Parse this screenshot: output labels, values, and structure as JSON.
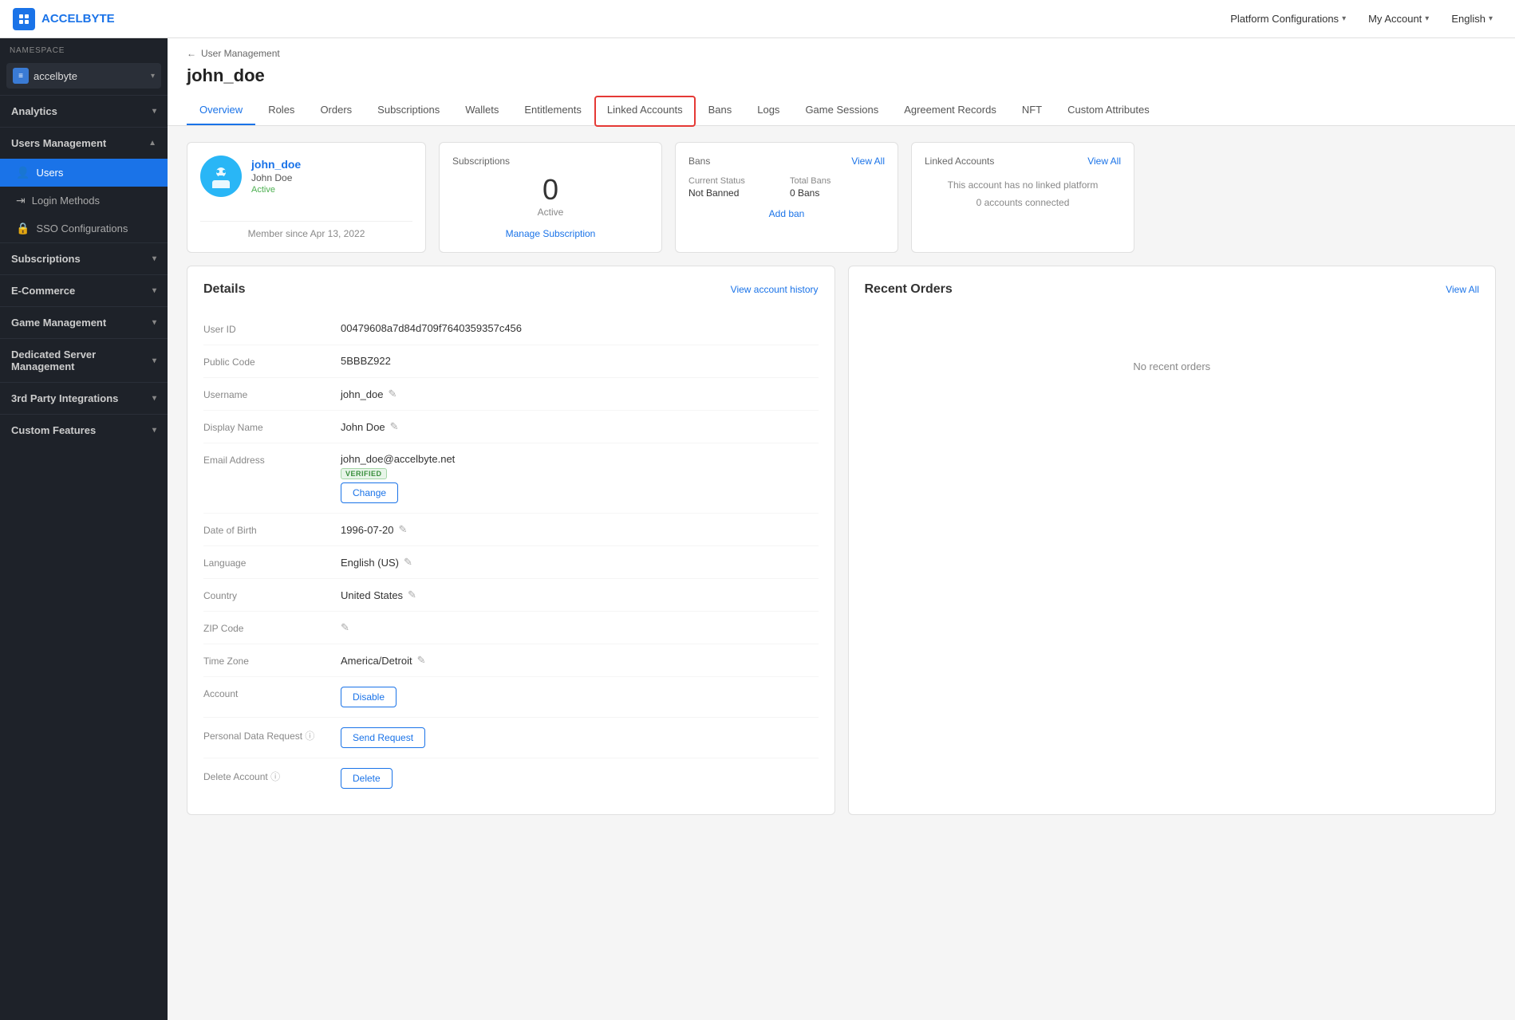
{
  "topNav": {
    "logo": "A3",
    "appName": "ACCELBYTE",
    "platformConfigurations": "Platform Configurations",
    "myAccount": "My Account",
    "language": "English"
  },
  "sidebar": {
    "namespace_label": "NAMESPACE",
    "namespace_value": "accelbyte",
    "sections": [
      {
        "id": "analytics",
        "label": "Analytics",
        "expanded": false,
        "items": []
      },
      {
        "id": "users-management",
        "label": "Users Management",
        "expanded": true,
        "items": [
          {
            "id": "users",
            "label": "Users",
            "icon": "👤",
            "active": true
          },
          {
            "id": "login-methods",
            "label": "Login Methods",
            "icon": "→",
            "active": false
          },
          {
            "id": "sso-configurations",
            "label": "SSO Configurations",
            "icon": "🔒",
            "active": false
          }
        ]
      },
      {
        "id": "subscriptions",
        "label": "Subscriptions",
        "expanded": false,
        "items": []
      },
      {
        "id": "ecommerce",
        "label": "E-Commerce",
        "expanded": false,
        "items": []
      },
      {
        "id": "game-management",
        "label": "Game Management",
        "expanded": false,
        "items": []
      },
      {
        "id": "dedicated-server",
        "label": "Dedicated Server Management",
        "expanded": false,
        "items": []
      },
      {
        "id": "3rd-party",
        "label": "3rd Party Integrations",
        "expanded": false,
        "items": []
      },
      {
        "id": "custom-features",
        "label": "Custom Features",
        "expanded": false,
        "items": []
      }
    ]
  },
  "breadcrumb": {
    "parent": "User Management",
    "arrow": "←"
  },
  "pageTitle": "john_doe",
  "tabs": [
    {
      "id": "overview",
      "label": "Overview",
      "active": true,
      "highlighted": false
    },
    {
      "id": "roles",
      "label": "Roles",
      "active": false,
      "highlighted": false
    },
    {
      "id": "orders",
      "label": "Orders",
      "active": false,
      "highlighted": false
    },
    {
      "id": "subscriptions",
      "label": "Subscriptions",
      "active": false,
      "highlighted": false
    },
    {
      "id": "wallets",
      "label": "Wallets",
      "active": false,
      "highlighted": false
    },
    {
      "id": "entitlements",
      "label": "Entitlements",
      "active": false,
      "highlighted": false
    },
    {
      "id": "linked-accounts",
      "label": "Linked Accounts",
      "active": false,
      "highlighted": true
    },
    {
      "id": "bans",
      "label": "Bans",
      "active": false,
      "highlighted": false
    },
    {
      "id": "logs",
      "label": "Logs",
      "active": false,
      "highlighted": false
    },
    {
      "id": "game-sessions",
      "label": "Game Sessions",
      "active": false,
      "highlighted": false
    },
    {
      "id": "agreement-records",
      "label": "Agreement Records",
      "active": false,
      "highlighted": false
    },
    {
      "id": "nft",
      "label": "NFT",
      "active": false,
      "highlighted": false
    },
    {
      "id": "custom-attributes",
      "label": "Custom Attributes",
      "active": false,
      "highlighted": false
    }
  ],
  "userCard": {
    "username": "john_doe",
    "displayName": "John Doe",
    "status": "Active",
    "memberSince": "Member since Apr 13, 2022",
    "avatarIcon": "👾"
  },
  "subscriptions": {
    "title": "Subscriptions",
    "count": "0",
    "countLabel": "Active",
    "manageLink": "Manage Subscription"
  },
  "bans": {
    "title": "Bans",
    "viewAllLabel": "View All",
    "currentStatusLabel": "Current Status",
    "currentStatusValue": "Not Banned",
    "totalBansLabel": "Total Bans",
    "totalBansValue": "0 Bans",
    "addBanLabel": "Add ban"
  },
  "linkedAccounts": {
    "title": "Linked Accounts",
    "viewAllLabel": "View All",
    "emptyMessage": "This account has no linked platform",
    "connectedCount": "0 accounts connected"
  },
  "details": {
    "title": "Details",
    "viewHistoryLabel": "View account history",
    "fields": [
      {
        "id": "user-id",
        "label": "User ID",
        "value": "00479608a7d84d709f7640359357c456",
        "editable": false
      },
      {
        "id": "public-code",
        "label": "Public Code",
        "value": "5BBBZ922",
        "editable": false
      },
      {
        "id": "username",
        "label": "Username",
        "value": "john_doe",
        "editable": true
      },
      {
        "id": "display-name",
        "label": "Display Name",
        "value": "John Doe",
        "editable": true
      },
      {
        "id": "email-address",
        "label": "Email Address",
        "value": "john_doe@accelbyte.net",
        "editable": false,
        "verified": true,
        "changeBtn": "Change"
      },
      {
        "id": "date-of-birth",
        "label": "Date of Birth",
        "value": "1996-07-20",
        "editable": true
      },
      {
        "id": "language",
        "label": "Language",
        "value": "English (US)",
        "editable": true
      },
      {
        "id": "country",
        "label": "Country",
        "value": "United States",
        "editable": true
      },
      {
        "id": "zip-code",
        "label": "ZIP Code",
        "value": "",
        "editable": true
      },
      {
        "id": "timezone",
        "label": "Time Zone",
        "value": "America/Detroit",
        "editable": true
      },
      {
        "id": "account",
        "label": "Account",
        "value": "",
        "disableBtn": "Disable"
      },
      {
        "id": "personal-data",
        "label": "Personal Data Request",
        "value": "",
        "sendBtn": "Send Request",
        "hasInfo": true
      },
      {
        "id": "delete-account",
        "label": "Delete Account",
        "value": "",
        "deleteBtn": "Delete",
        "hasInfo": true
      }
    ]
  },
  "recentOrders": {
    "title": "Recent Orders",
    "viewAllLabel": "View All",
    "emptyMessage": "No recent orders"
  }
}
